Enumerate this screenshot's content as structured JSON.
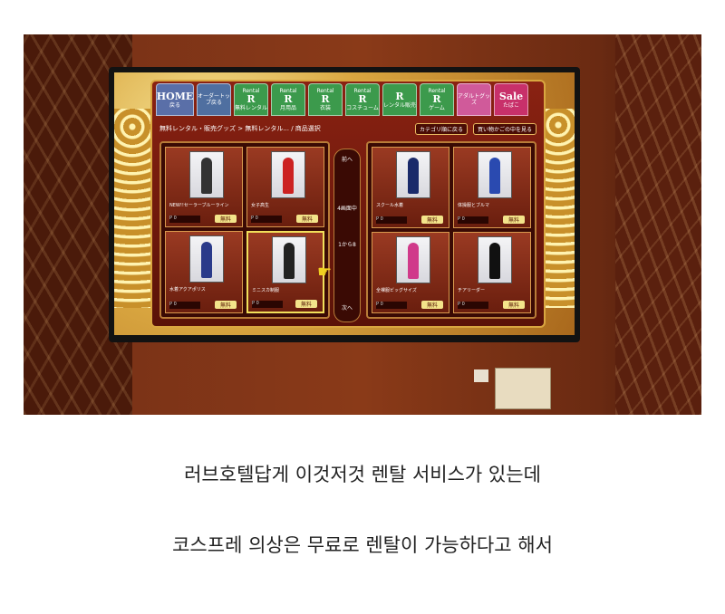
{
  "photo": {
    "tabs": [
      {
        "top": "",
        "big": "HOME",
        "sub": "戻る",
        "kind": "home"
      },
      {
        "top": "",
        "big": "",
        "sub": "オーダートップ戻る",
        "kind": "order"
      },
      {
        "top": "Rental",
        "big": "R",
        "sub": "無料レンタル",
        "kind": "rental"
      },
      {
        "top": "Rental",
        "big": "R",
        "sub": "月用品",
        "kind": "rental"
      },
      {
        "top": "Rental",
        "big": "R",
        "sub": "衣装",
        "kind": "rental"
      },
      {
        "top": "Rental",
        "big": "R",
        "sub": "コスチューム",
        "kind": "rental"
      },
      {
        "top": "",
        "big": "R",
        "sub": "レンタル販売",
        "kind": "rental"
      },
      {
        "top": "Rental",
        "big": "R",
        "sub": "ゲーム",
        "kind": "rental"
      },
      {
        "top": "",
        "big": "",
        "sub": "アダルトグッズ",
        "kind": "pink"
      },
      {
        "top": "",
        "big": "Sale",
        "sub": "たばこ",
        "kind": "sale"
      }
    ],
    "breadcrumb": "無料レンタル・販売グッズ > 無料レンタル... / 商品選択",
    "category_button": "カテゴリ順に戻る",
    "cart_button": "買い物かごの中を見る",
    "free_label": "無料",
    "price_placeholder": "0",
    "scroller": {
      "prev": "前へ",
      "page": "4画面中",
      "index": "1から8",
      "next": "次へ"
    },
    "left_items": [
      {
        "label": "NEW!!セーラーブルーライン",
        "fig": "#333"
      },
      {
        "label": "女子高生",
        "fig": "#c22"
      },
      {
        "label": "水着アクアポリス",
        "fig": "#2a3a8a"
      },
      {
        "label": "ミニスカ制服",
        "fig": "#222"
      }
    ],
    "right_items": [
      {
        "label": "スクール水着",
        "fig": "#1a2a6a"
      },
      {
        "label": "体操服とブルマ",
        "fig": "#2a4ab0"
      },
      {
        "label": "全裸服ビッグサイズ",
        "fig": "#d03a8a"
      },
      {
        "label": "チアリーダー",
        "fig": "#111"
      }
    ]
  },
  "captions": {
    "line1": "러브호텔답게 이것저것 렌탈 서비스가 있는데",
    "line2": "코스프레 의상은 무료로 렌탈이 가능하다고 해서"
  },
  "colors": {
    "wall": "#8a3a18",
    "panel": "#6a1a0a",
    "accent": "#d9a640",
    "select": "#f2e05a"
  }
}
